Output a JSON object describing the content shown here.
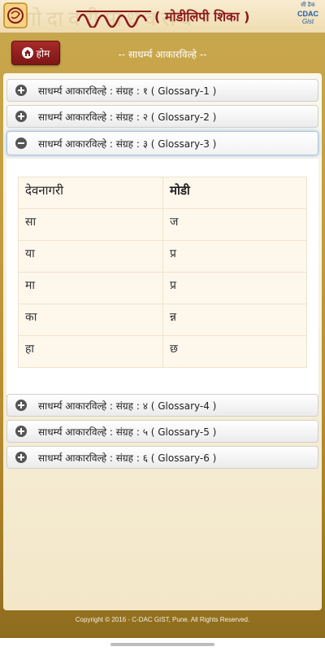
{
  "header": {
    "watermark": "गोदावरीमाधवराव",
    "logo_text": "मोडीलिपी",
    "title": "( मोडीलिपी शिका )",
    "cdac_line1": "सी डैक",
    "cdac_line2": "CDAC",
    "cdac_line3": "Gist"
  },
  "toolbar": {
    "home_label": "होम",
    "page_heading": "-- साधर्म्य आकारविल्हे --"
  },
  "accordion": [
    {
      "label": "साधर्म्य आकारविल्हे : संग्रह : १ ( Glossary-1 )",
      "expanded": false
    },
    {
      "label": "साधर्म्य आकारविल्हे : संग्रह : २ ( Glossary-2 )",
      "expanded": false
    },
    {
      "label": "साधर्म्य आकारविल्हे : संग्रह : ३ ( Glossary-3 )",
      "expanded": true
    },
    {
      "label": "साधर्म्य आकारविल्हे : संग्रह : ४ ( Glossary-4 )",
      "expanded": false
    },
    {
      "label": "साधर्म्य आकारविल्हे : संग्रह : ५ ( Glossary-5 )",
      "expanded": false
    },
    {
      "label": "साधर्म्य आकारविल्हे : संग्रह : ६ ( Glossary-6 )",
      "expanded": false
    }
  ],
  "glossary_table": {
    "headers": [
      "देवनागरी",
      "मोडी"
    ],
    "rows": [
      {
        "devanagari": "सा",
        "modi": "ज"
      },
      {
        "devanagari": "या",
        "modi": "प्र"
      },
      {
        "devanagari": "मा",
        "modi": "प्र"
      },
      {
        "devanagari": "का",
        "modi": "न्न"
      },
      {
        "devanagari": "हा",
        "modi": "छ"
      }
    ]
  },
  "footer": {
    "copyright": "Copyright © 2016 - C-DAC GIST, Pune. All Rights Reserved."
  },
  "colors": {
    "accent": "#8b1a1a",
    "background_gold": "#c49f42",
    "cdac_blue": "#1d5aa8"
  }
}
